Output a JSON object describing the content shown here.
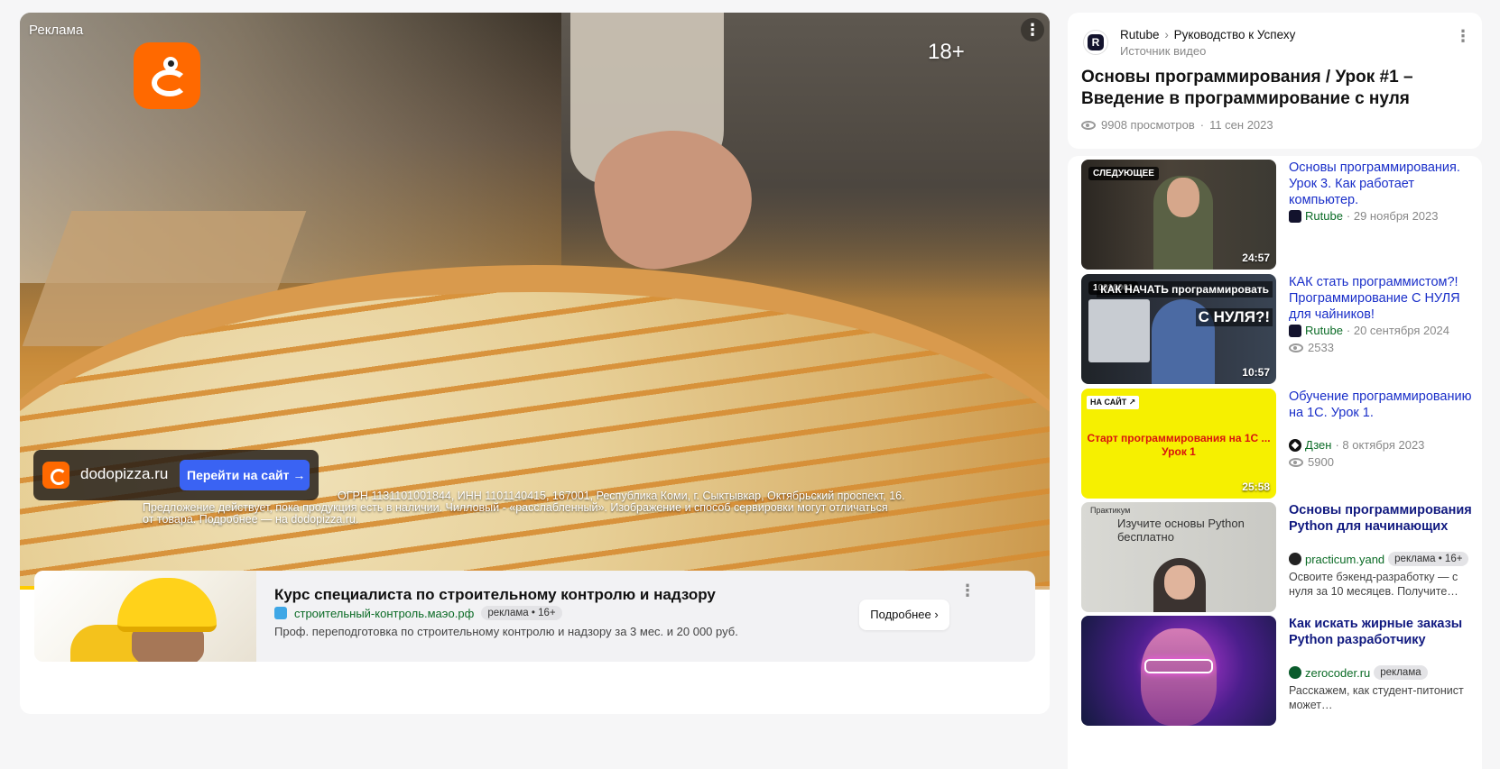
{
  "ad": {
    "tag": "Реклама",
    "age": "18+",
    "domain": "dodopizza.ru",
    "cta": "Перейти на сайт",
    "legal_line1": "ОГРН 1131101001844, ИНН 1101140415, 167001, Республика Коми, г. Сыктывкар, Октябрьский проспект, 16.",
    "legal_line2": "Предложение действует, пока продукция есть в наличии. Чилловый - «расслабленный». Изображение и способ сервировки могут отличаться",
    "legal_line3": "от товара. Подробнее — на dodopizza.ru."
  },
  "banner": {
    "title": "Курс специалиста по строительному контролю и надзору",
    "link": "строительный-контроль.маэо.рф",
    "badge": "реклама • 16+",
    "description": "Проф. переподготовка по строительному контролю и надзору за 3 мес. и 20 000 руб.",
    "button": "Подробнее"
  },
  "video_info": {
    "channel": "Rutube",
    "separator": "›",
    "channel_section": "Руководство к Успеху",
    "source_label": "Источник видео",
    "title": "Основы программирования / Урок #1 – Введение в программирование с нуля",
    "views": "9908 просмотров",
    "dot": "·",
    "date": "11 сен 2023"
  },
  "recommendations": [
    {
      "badge": "СЛЕДУЮЩЕЕ",
      "duration": "24:57",
      "title": "Основы программирования. Урок 3. Как работает компьютер.",
      "source": "Rutube",
      "date": "· 29 ноября 2023"
    },
    {
      "badge": "10010001",
      "headline": "КАК НАЧАТЬ программировать",
      "headline2": "С НУЛЯ?!",
      "duration": "10:57",
      "title": "КАК стать программистом?! Программирование С НУЛЯ для чайников!",
      "source": "Rutube",
      "date": "· 20 сентября 2024",
      "views": "2533"
    },
    {
      "badge": "НА САЙТ ↗",
      "thumb_text": "Старт программирования на 1С ... Урок 1",
      "duration": "25:58",
      "title": "Обучение программированию на 1С. Урок 1.",
      "source": "Дзен",
      "date": "· 8 октября 2023",
      "views": "5900"
    },
    {
      "thumb_brand": "Практикум",
      "thumb_text": "Изучите основы Python бесплатно",
      "title": "Основы программирования Python для начинающих",
      "source": "practicum.yand",
      "badge": "реклама • 16+",
      "description": "Освоите бэкенд-разработку — с нуля за 10 месяцев. Получите…"
    },
    {
      "title": "Как искать жирные заказы Python разработчику",
      "source": "zerocoder.ru",
      "badge": "реклама",
      "description": "Расскажем, как студент-питонист может…"
    }
  ]
}
